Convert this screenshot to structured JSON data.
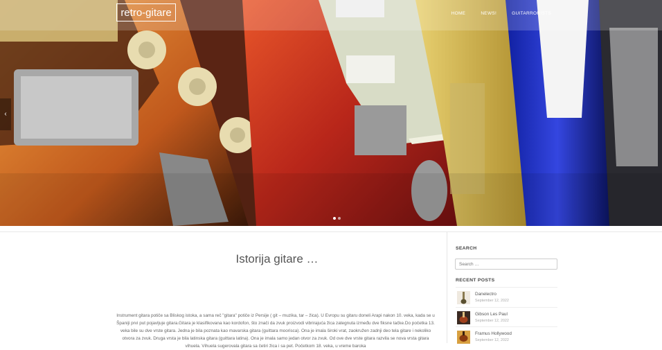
{
  "header": {
    "logo": "retro-gitare",
    "nav": [
      "HOME",
      "NEWS!",
      "GUITARRORISTS"
    ]
  },
  "slider": {
    "prev_icon": "chevron-left-icon",
    "dots": 2,
    "active_dot": 0
  },
  "post": {
    "title": "Istorija gitare …",
    "body": "Instrument gitara potiče sa Bliskog istoka, a sama reč \"gitara\" potiče iz Persije ( git – muzika, tar – žica). U Evropu su gitaru doneli Arapi nakon 10. veka, kada se u Španiji prvi put pojavljuje gitara.Gitara je klasifikovana kao kordofon, što znači da zvuk proizvodi vibrirajuća žica zategnuta između dve fiksne tačke.Do početka 13. veka bile su dve vrste gitara. Jedna je bila poznata kao mavarska gitara (guittara moorisca). Ona je imala široki vrat, zaokružen zadnji deo tela gitare i nekoliko otvora za zvuk. Druga vrsta je bila latinska gitara (guittara latina). Ona je imala samo jedan otvor za zvuk. Od ove dve vrste gitara razvila se nova vrsta gitara vihuela. Vihuela sugerovala gitara sa četiri žica i sa pet. Početkom 18. veka, u vreme baroka"
  },
  "sidebar": {
    "search_title": "SEARCH",
    "search_placeholder": "Search …",
    "recent_title": "RECENT POSTS",
    "recent": [
      {
        "title": "Danelectro",
        "date": "September 12, 2022"
      },
      {
        "title": "Gibson Les Paul",
        "date": "September 12, 2022"
      },
      {
        "title": "Framus Hollywood",
        "date": "September 12, 2022"
      }
    ]
  },
  "colors": {
    "accent": "#ffffff",
    "guitar_red": "#c0321c",
    "guitar_sunburst": "#d9782a",
    "guitar_blue": "#1e2fb8",
    "pickguard": "#d8dcc6"
  }
}
